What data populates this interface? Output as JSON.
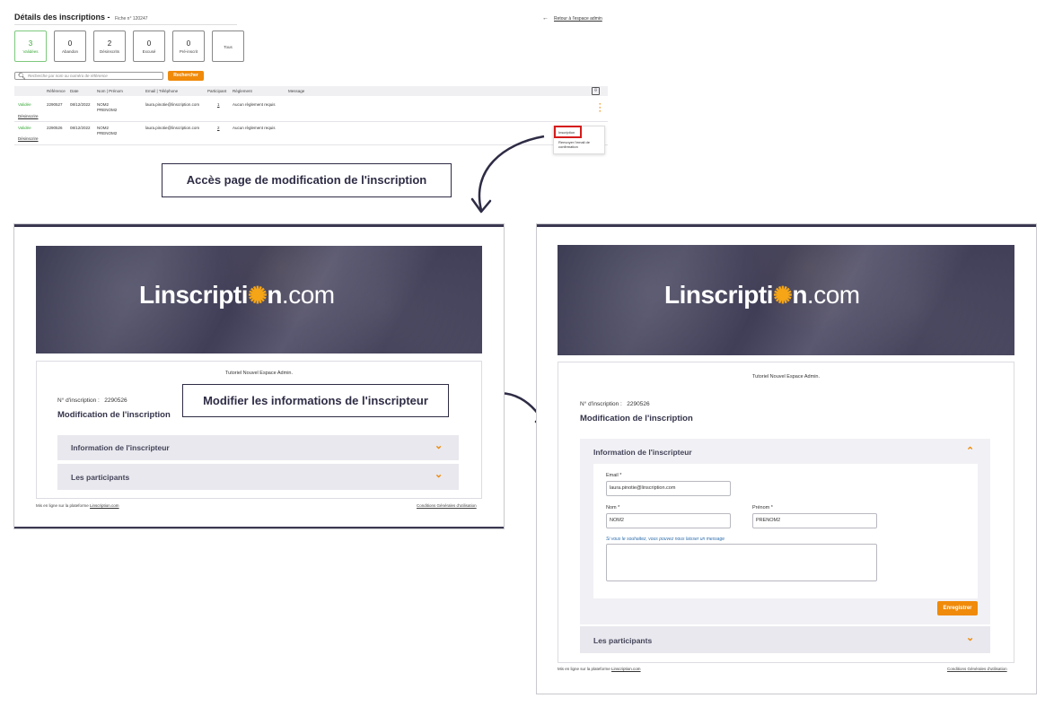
{
  "admin": {
    "title": "Détails des inscriptions -",
    "fiche": "Fiche n° 120247",
    "back_link": "Retour à l'espace admin",
    "stats": [
      {
        "count": "3",
        "label": "Validées"
      },
      {
        "count": "0",
        "label": "Abandon"
      },
      {
        "count": "2",
        "label": "Désinscrits"
      },
      {
        "count": "0",
        "label": "Excusé"
      },
      {
        "count": "0",
        "label": "Pré-inscrit"
      },
      {
        "count": "",
        "label": "Tous"
      }
    ],
    "search_placeholder": "Recherche par nom ou numéro de référence",
    "search_button": "Rechercher",
    "columns": [
      "Référence",
      "Date",
      "Nom | Prénom",
      "Email | Téléphone",
      "Participant",
      "Règlement",
      "Message"
    ],
    "rows": [
      {
        "status": "Validée",
        "action": "Désinscrire",
        "ref": "2290527",
        "date": "08/12/2022",
        "nom": "NOM2",
        "prenom": "PRENOM2",
        "email": "laura.pinotie@linscription.com",
        "participant": "1",
        "reglement": "Aucun règlement requis"
      },
      {
        "status": "Validée",
        "action": "Désinscrire",
        "ref": "2290526",
        "date": "08/12/2022",
        "nom": "NOM2",
        "prenom": "PRENOM2",
        "email": "laura.pinotie@linscription.com",
        "participant": "2",
        "reglement": "Aucun règlement requis"
      }
    ],
    "context_menu": {
      "item1": "Inscription",
      "item2": "Renvoyer l'email de confirmation"
    }
  },
  "callouts": {
    "first": "Accès page de modification de l'inscription",
    "second": "Modifier les informations de l'inscripteur"
  },
  "left_page": {
    "logo_main": "Linscripti",
    "logo_end": "n",
    "logo_com": ".com",
    "event": "Tutoriel Nouvel Espace Admin.",
    "inscription_label": "N° d'inscription :",
    "inscription_number": "2290526",
    "heading": "Modification de l'inscription",
    "acc1": "Information de l'inscripteur",
    "acc2": "Les participants",
    "footer_left_prefix": "Mis en ligne sur la plateforme",
    "footer_left_link": "Linscription.com",
    "footer_right": "Conditions Générales d'utilisation"
  },
  "right_page": {
    "logo_main": "Linscripti",
    "logo_end": "n",
    "logo_com": ".com",
    "event": "Tutoriel Nouvel Espace Admin.",
    "inscription_label": "N° d'inscription :",
    "inscription_number": "2290526",
    "heading": "Modification de l'inscription",
    "acc1": "Information de l'inscripteur",
    "email_label": "Email *",
    "email_value": "laura.pinotie@linscription.com",
    "nom_label": "Nom *",
    "nom_value": "NOM2",
    "prenom_label": "Prénom *",
    "prenom_value": "PRENOM2",
    "message_hint": "Si vous le souhaitez, vous pouvez nous laisser un message",
    "save_button": "Enregistrer",
    "acc2": "Les participants",
    "footer_left_prefix": "Mis en ligne sur la plateforme",
    "footer_left_link": "Linscription.com",
    "footer_right": "Conditions Générales d'utilisation"
  },
  "colors": {
    "accent": "#f08a0a",
    "green": "#3aa83a",
    "navy": "#2e2c45",
    "highlight": "#d61b1b"
  }
}
